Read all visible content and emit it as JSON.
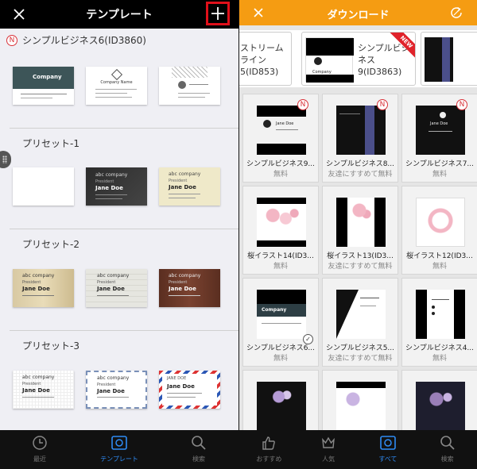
{
  "left": {
    "header": {
      "title": "テンプレート"
    },
    "subtitle": "シンプルビジネス6(ID3860)",
    "n_badge": "N",
    "sections": [
      {
        "label": "プリセット-1"
      },
      {
        "label": "プリセット-2"
      },
      {
        "label": "プリセット-3"
      }
    ],
    "cards": {
      "company": "Company",
      "company_name": "Company Name",
      "abc": "abc company",
      "president": "President",
      "jane": "Jane Doe",
      "jane_upper": "JANE DOE"
    },
    "tabs": [
      {
        "label": "最近",
        "icon": "clock-icon"
      },
      {
        "label": "テンプレート",
        "icon": "template-icon"
      },
      {
        "label": "検索",
        "icon": "search-icon"
      }
    ]
  },
  "right": {
    "header": {
      "title": "ダウンロード"
    },
    "carousel": [
      {
        "label": "ストリームライン 5(ID853)"
      },
      {
        "label": "シンプルビジネス9(ID3863)",
        "badge": "NEW"
      }
    ],
    "grid": [
      {
        "name": "シンプルビジネス9...",
        "sub": "無料",
        "badge": "N"
      },
      {
        "name": "シンプルビジネス8...",
        "sub": "友達にすすめて無料",
        "badge": "N"
      },
      {
        "name": "シンプルビジネス7...",
        "sub": "無料",
        "badge": "N"
      },
      {
        "name": "桜イラスト14(ID3...",
        "sub": "無料"
      },
      {
        "name": "桜イラスト13(ID3...",
        "sub": "友達にすすめて無料"
      },
      {
        "name": "桜イラスト12(ID3...",
        "sub": "無料"
      },
      {
        "name": "シンプルビジネス6...",
        "sub": "無料",
        "checked": true
      },
      {
        "name": "シンプルビジネス5...",
        "sub": "友達にすすめて無料"
      },
      {
        "name": "シンプルビジネス4...",
        "sub": "無料"
      }
    ],
    "card_text": {
      "jane": "Jane Doe",
      "company": "Company"
    },
    "tabs": [
      {
        "label": "おすすめ",
        "icon": "thumbs-up-icon"
      },
      {
        "label": "人気",
        "icon": "crown-icon"
      },
      {
        "label": "すべて",
        "icon": "grid-icon"
      },
      {
        "label": "検索",
        "icon": "search-icon"
      }
    ]
  },
  "colors": {
    "accent_orange": "#f59c12",
    "active_blue": "#2f8cf5",
    "highlight_red": "#e0101a"
  }
}
